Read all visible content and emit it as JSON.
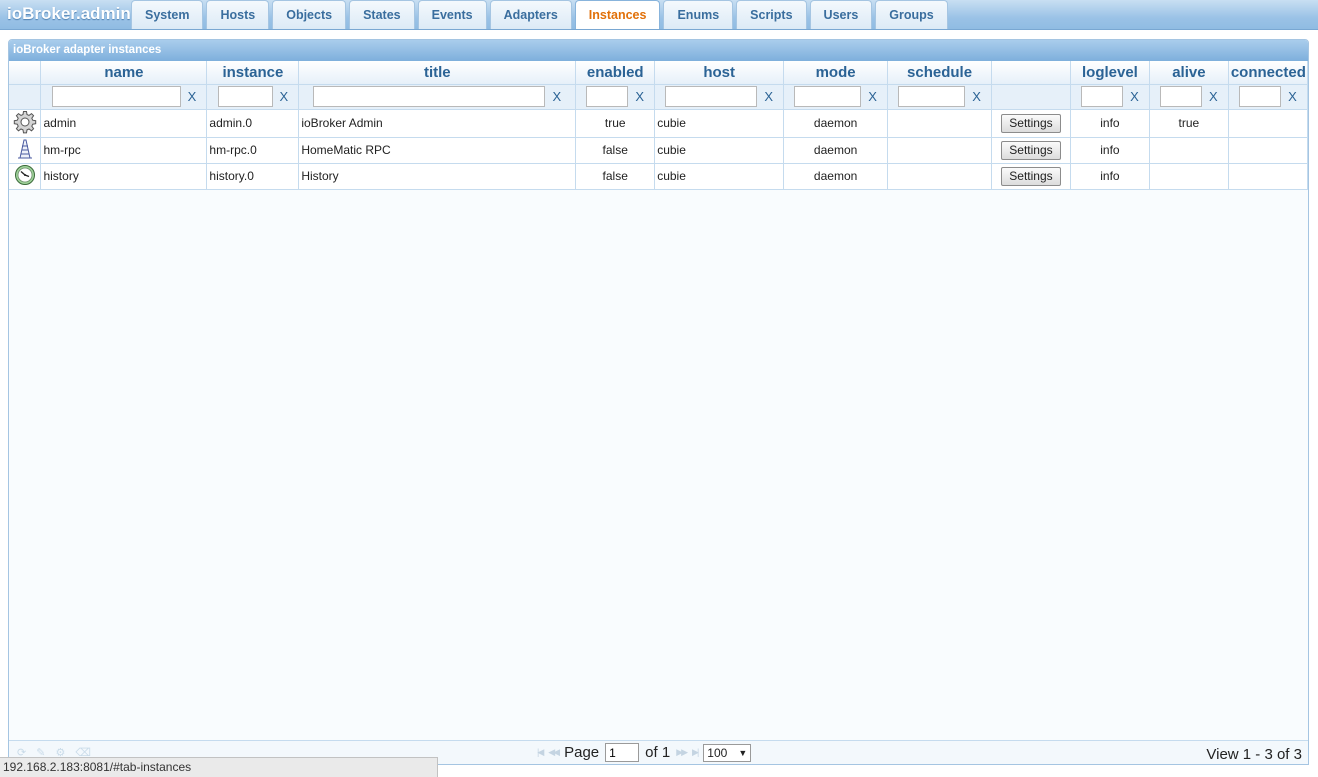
{
  "app": {
    "title": "ioBroker.admin"
  },
  "tabs": [
    {
      "label": "System"
    },
    {
      "label": "Hosts"
    },
    {
      "label": "Objects"
    },
    {
      "label": "States"
    },
    {
      "label": "Events"
    },
    {
      "label": "Adapters"
    },
    {
      "label": "Instances",
      "active": true
    },
    {
      "label": "Enums"
    },
    {
      "label": "Scripts"
    },
    {
      "label": "Users"
    },
    {
      "label": "Groups"
    }
  ],
  "grid": {
    "caption": "ioBroker adapter instances",
    "columns": [
      "",
      "name",
      "instance",
      "title",
      "enabled",
      "host",
      "mode",
      "schedule",
      "",
      "loglevel",
      "alive",
      "connected"
    ],
    "filter_clear": "X",
    "rows": [
      {
        "icon": "gear-icon",
        "name": "admin",
        "instance": "admin.0",
        "title": "ioBroker Admin",
        "enabled": "true",
        "host": "cubie",
        "mode": "daemon",
        "schedule": "",
        "button": "Settings",
        "loglevel": "info",
        "alive": "true",
        "connected": ""
      },
      {
        "icon": "device-icon",
        "name": "hm-rpc",
        "instance": "hm-rpc.0",
        "title": "HomeMatic RPC",
        "enabled": "false",
        "host": "cubie",
        "mode": "daemon",
        "schedule": "",
        "button": "Settings",
        "loglevel": "info",
        "alive": "",
        "connected": ""
      },
      {
        "icon": "clock-icon",
        "name": "history",
        "instance": "history.0",
        "title": "History",
        "enabled": "false",
        "host": "cubie",
        "mode": "daemon",
        "schedule": "",
        "button": "Settings",
        "loglevel": "info",
        "alive": "",
        "connected": ""
      }
    ]
  },
  "pager": {
    "page_label": "Page",
    "page_value": "1",
    "of_label": "of 1",
    "rows_per_page": "100",
    "view_info": "View 1 - 3 of 3"
  },
  "status_bar": {
    "url": "192.168.2.183:8081/#tab-instances"
  },
  "colors": {
    "accent": "#e17009",
    "header_text": "#2b6395",
    "caption_bg": "#7eafdc"
  }
}
